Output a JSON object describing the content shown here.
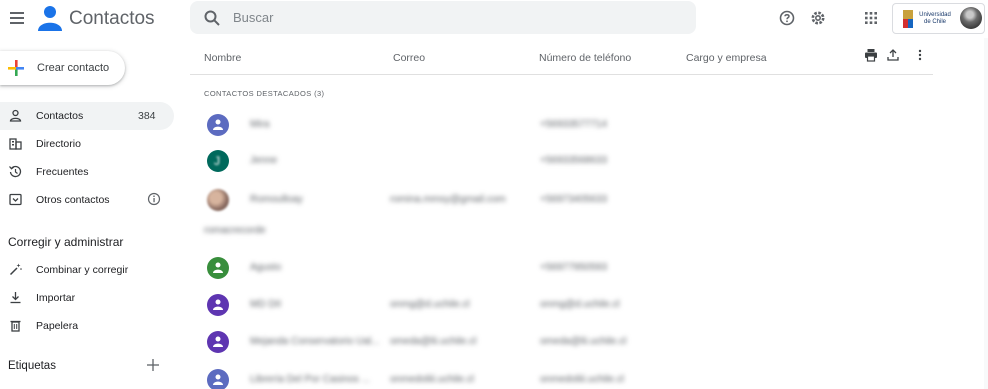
{
  "app": {
    "title": "Contactos"
  },
  "search": {
    "placeholder": "Buscar"
  },
  "account": {
    "org_line1": "Universidad",
    "org_line2": "de Chile"
  },
  "sidebar": {
    "create_label": "Crear contacto",
    "items": [
      {
        "label": "Contactos",
        "count": "384",
        "icon": "person-icon"
      },
      {
        "label": "Directorio",
        "icon": "building-icon"
      },
      {
        "label": "Frecuentes",
        "icon": "history-icon"
      },
      {
        "label": "Otros contactos",
        "icon": "archive-icon"
      }
    ],
    "manage_title": "Corregir y administrar",
    "manage_items": [
      {
        "label": "Combinar y corregir",
        "icon": "magic-wand-icon"
      },
      {
        "label": "Importar",
        "icon": "download-icon"
      },
      {
        "label": "Papelera",
        "icon": "trash-icon"
      }
    ],
    "labels_title": "Etiquetas"
  },
  "table": {
    "columns": [
      "Nombre",
      "Correo",
      "Número de teléfono",
      "Cargo y empresa"
    ],
    "section_label": "CONTACTOS DESTACADOS (3)",
    "rows": [
      {
        "name": "Mira",
        "email": "",
        "phone": "+56933577714",
        "avatar_color": "#5c6bc0",
        "avatar_type": "icon"
      },
      {
        "name": "Jenne",
        "email": "",
        "phone": "+56933568633",
        "avatar_color": "#00695c",
        "avatar_type": "letter",
        "letter": "J"
      },
      {
        "name": "Romoulloay",
        "email": "romina.mmsy@gmail.com",
        "phone": "+56973405633",
        "avatar_color": "#8d6e63",
        "avatar_type": "photo"
      },
      {
        "name": "Agusto",
        "email": "",
        "phone": "+56977950593",
        "avatar_color": "#388e3c",
        "avatar_type": "icon"
      },
      {
        "name": "MD DII",
        "email": "onmg@d.uchile.cl",
        "phone": "onmg@d.uchile.cl",
        "avatar_color": "#5e35b1",
        "avatar_type": "icon"
      },
      {
        "name": "Mejanda Conservatorio Ual...",
        "email": "omeda@lii.uchile.cl",
        "phone": "omeda@lii.uchile.cl",
        "avatar_color": "#5e35b1",
        "avatar_type": "icon"
      },
      {
        "name": "Librería Del Por Casinos ...",
        "email": "onmedoliii.uchile.cl",
        "phone": "onmedoliii.uchile.cl",
        "avatar_color": "#5c6bc0",
        "avatar_type": "icon"
      }
    ],
    "separator_text": "romacrecorde"
  },
  "colors": {
    "accent": "#1a73e8",
    "text": "#202124",
    "muted": "#5f6368"
  }
}
